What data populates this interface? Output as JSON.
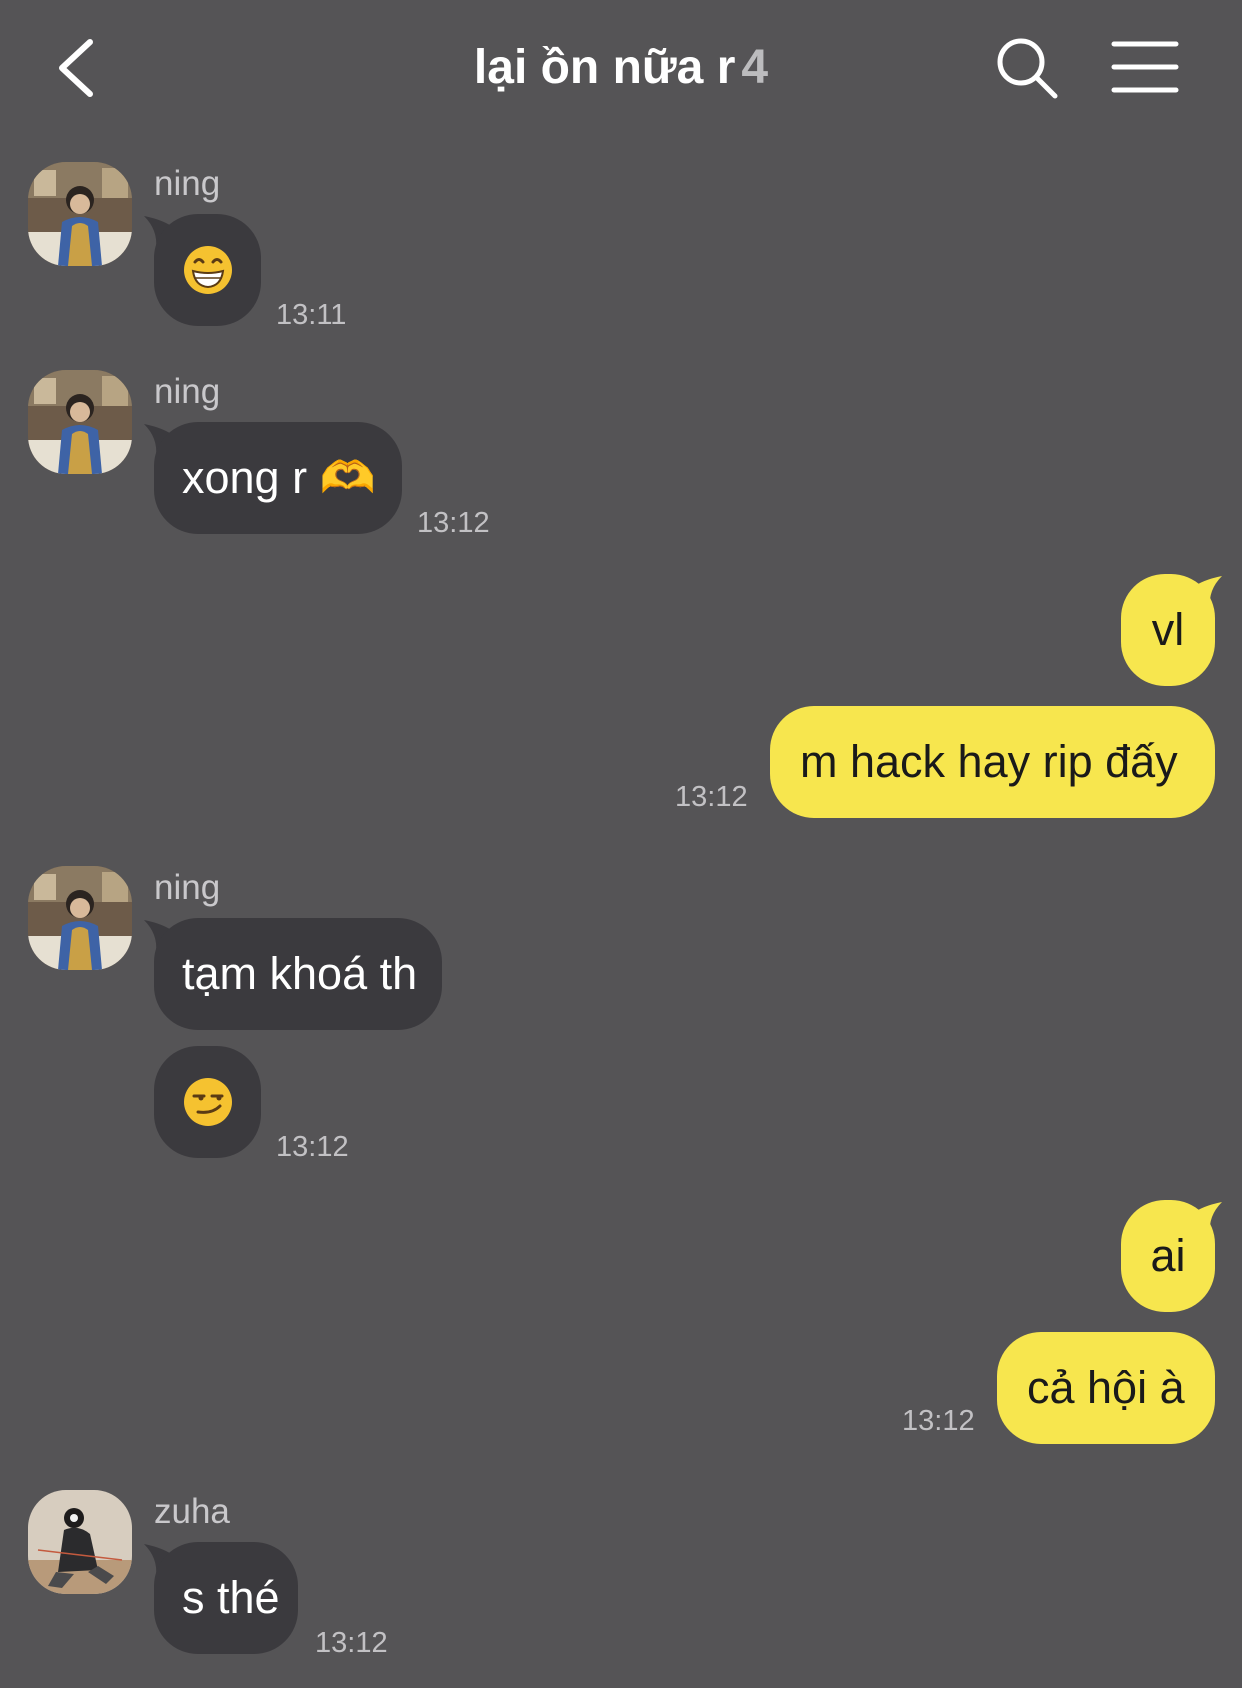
{
  "header": {
    "title": "lại ồn nữa r",
    "member_count": "4"
  },
  "messages": [
    {
      "sender": "ning",
      "text": "😁",
      "time": "13:11"
    },
    {
      "sender": "ning",
      "text": "xong r 🫶",
      "time": "13:12"
    },
    {
      "text": "vl"
    },
    {
      "text": "m hack hay rip đấy",
      "time": "13:12"
    },
    {
      "sender": "ning",
      "text": "tạm khoá th"
    },
    {
      "text": "😏",
      "time": "13:12"
    },
    {
      "text": "ai"
    },
    {
      "text": "cả hội à",
      "time": "13:12"
    },
    {
      "sender": "zuha",
      "text": "s thé",
      "time": "13:12"
    }
  ],
  "colors": {
    "background": "#555456",
    "incoming_bubble": "#3b3a3e",
    "outgoing_bubble": "#f7e64e"
  }
}
